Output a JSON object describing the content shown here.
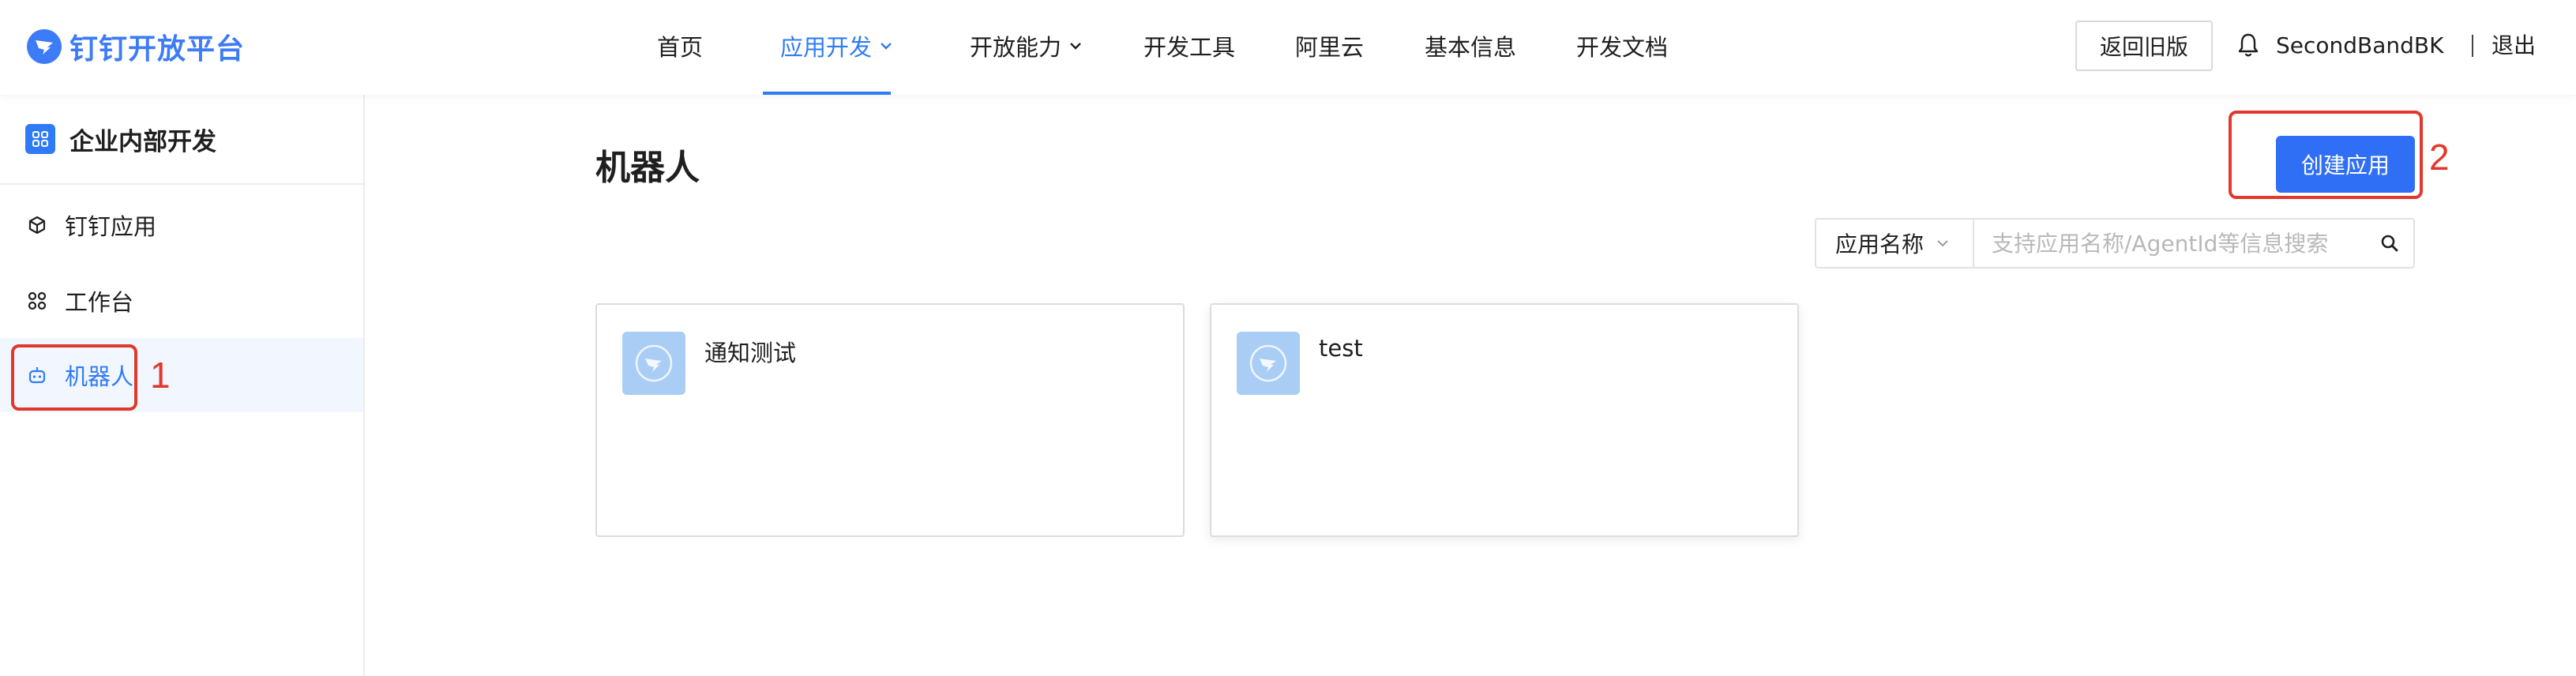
{
  "brand": {
    "name": "钉钉开放平台"
  },
  "nav": {
    "items": [
      {
        "label": "首页",
        "active": false,
        "dropdown": false
      },
      {
        "label": "应用开发",
        "active": true,
        "dropdown": true
      },
      {
        "label": "开放能力",
        "active": false,
        "dropdown": true
      },
      {
        "label": "开发工具",
        "active": false,
        "dropdown": false
      },
      {
        "label": "阿里云",
        "active": false,
        "dropdown": false
      },
      {
        "label": "基本信息",
        "active": false,
        "dropdown": false
      },
      {
        "label": "开发文档",
        "active": false,
        "dropdown": false
      }
    ],
    "old_version_label": "返回旧版",
    "username": "SecondBandBK",
    "logout_label": "退出"
  },
  "sidebar": {
    "title": "企业内部开发",
    "items": [
      {
        "label": "钉钉应用",
        "icon": "cube-icon",
        "active": false
      },
      {
        "label": "工作台",
        "icon": "command-icon",
        "active": false
      },
      {
        "label": "机器人",
        "icon": "robot-icon",
        "active": true
      }
    ]
  },
  "main": {
    "title": "机器人",
    "create_label": "创建应用",
    "search": {
      "field_label": "应用名称",
      "placeholder": "支持应用名称/AgentId等信息搜索"
    },
    "cards": [
      {
        "name": "通知测试"
      },
      {
        "name": "test"
      }
    ]
  },
  "annotations": {
    "step1": "1",
    "step2": "2"
  },
  "colors": {
    "accent": "#2f7bf6",
    "annotation": "#e0392b",
    "card_icon_bg": "#a9cdf5"
  }
}
